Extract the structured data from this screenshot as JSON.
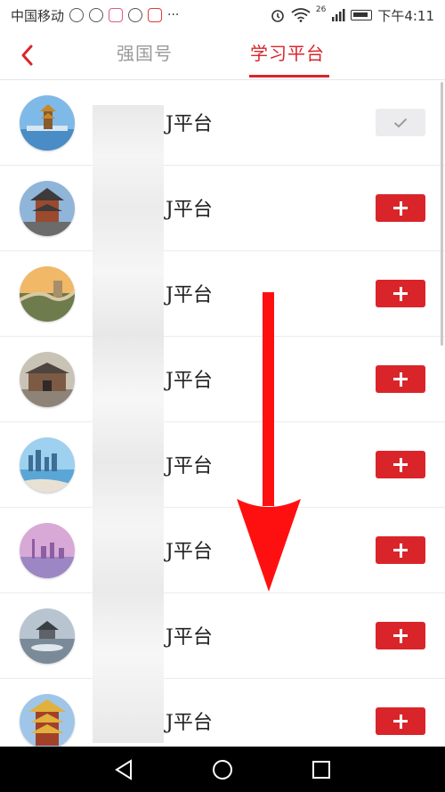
{
  "status_bar": {
    "carrier": "中国移动",
    "time": "下午4:11",
    "network_badge": "26"
  },
  "header": {
    "tabs": [
      {
        "label": "强国号",
        "active": false
      },
      {
        "label": "学习平台",
        "active": true
      }
    ]
  },
  "colors": {
    "accent": "#d9252a",
    "add_button": "#d9252a",
    "subscribed_button": "#ececee"
  },
  "list": {
    "items": [
      {
        "label_suffix": "J平台",
        "avatar": "pagoda-city-icon",
        "state": "subscribed"
      },
      {
        "label_suffix": "J平台",
        "avatar": "tower-pavilion-icon",
        "state": "add"
      },
      {
        "label_suffix": "J平台",
        "avatar": "great-wall-icon",
        "state": "add"
      },
      {
        "label_suffix": "J平台",
        "avatar": "old-gate-icon",
        "state": "add"
      },
      {
        "label_suffix": "J平台",
        "avatar": "coastal-city-icon",
        "state": "add"
      },
      {
        "label_suffix": "J平台",
        "avatar": "pink-skyline-icon",
        "state": "add"
      },
      {
        "label_suffix": "J平台",
        "avatar": "lake-pavilion-icon",
        "state": "add"
      },
      {
        "label_suffix": "J平台",
        "avatar": "yellow-tower-icon",
        "state": "add"
      }
    ]
  }
}
